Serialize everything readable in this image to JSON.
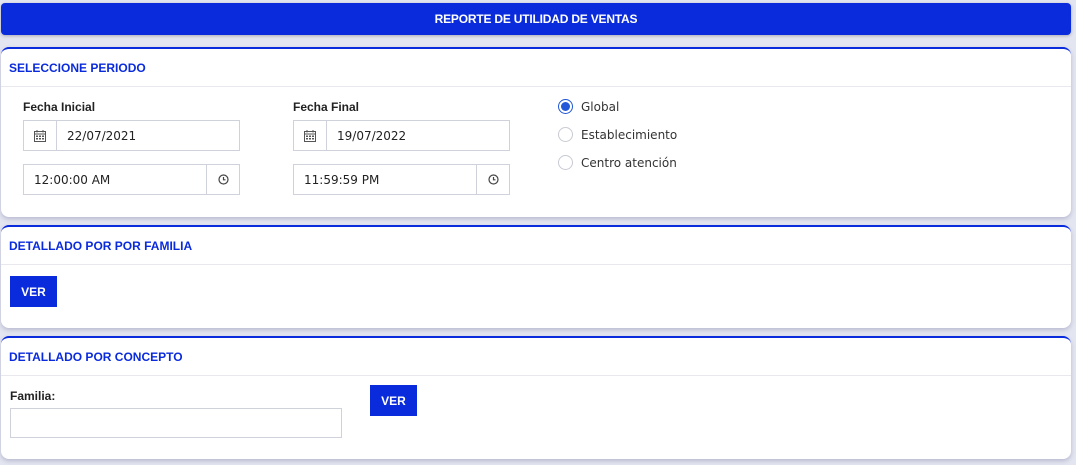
{
  "header": {
    "title": "REPORTE DE UTILIDAD DE VENTAS"
  },
  "period": {
    "title": "SELECCIONE PERIODO",
    "start": {
      "label": "Fecha Inicial",
      "date": "22/07/2021",
      "time": "12:00:00 AM"
    },
    "end": {
      "label": "Fecha Final",
      "date": "19/07/2022",
      "time": "11:59:59 PM"
    },
    "options": [
      "Global",
      "Establecimiento",
      "Centro atención"
    ],
    "selected": "Global"
  },
  "by_family": {
    "title": "DETALLADO POR POR FAMILIA",
    "button": "VER"
  },
  "by_concept": {
    "title": "DETALLADO POR CONCEPTO",
    "family_label": "Familia:",
    "family_value": "",
    "button": "VER"
  },
  "icons": {
    "date": "calendar-icon",
    "time": "clock-icon"
  }
}
